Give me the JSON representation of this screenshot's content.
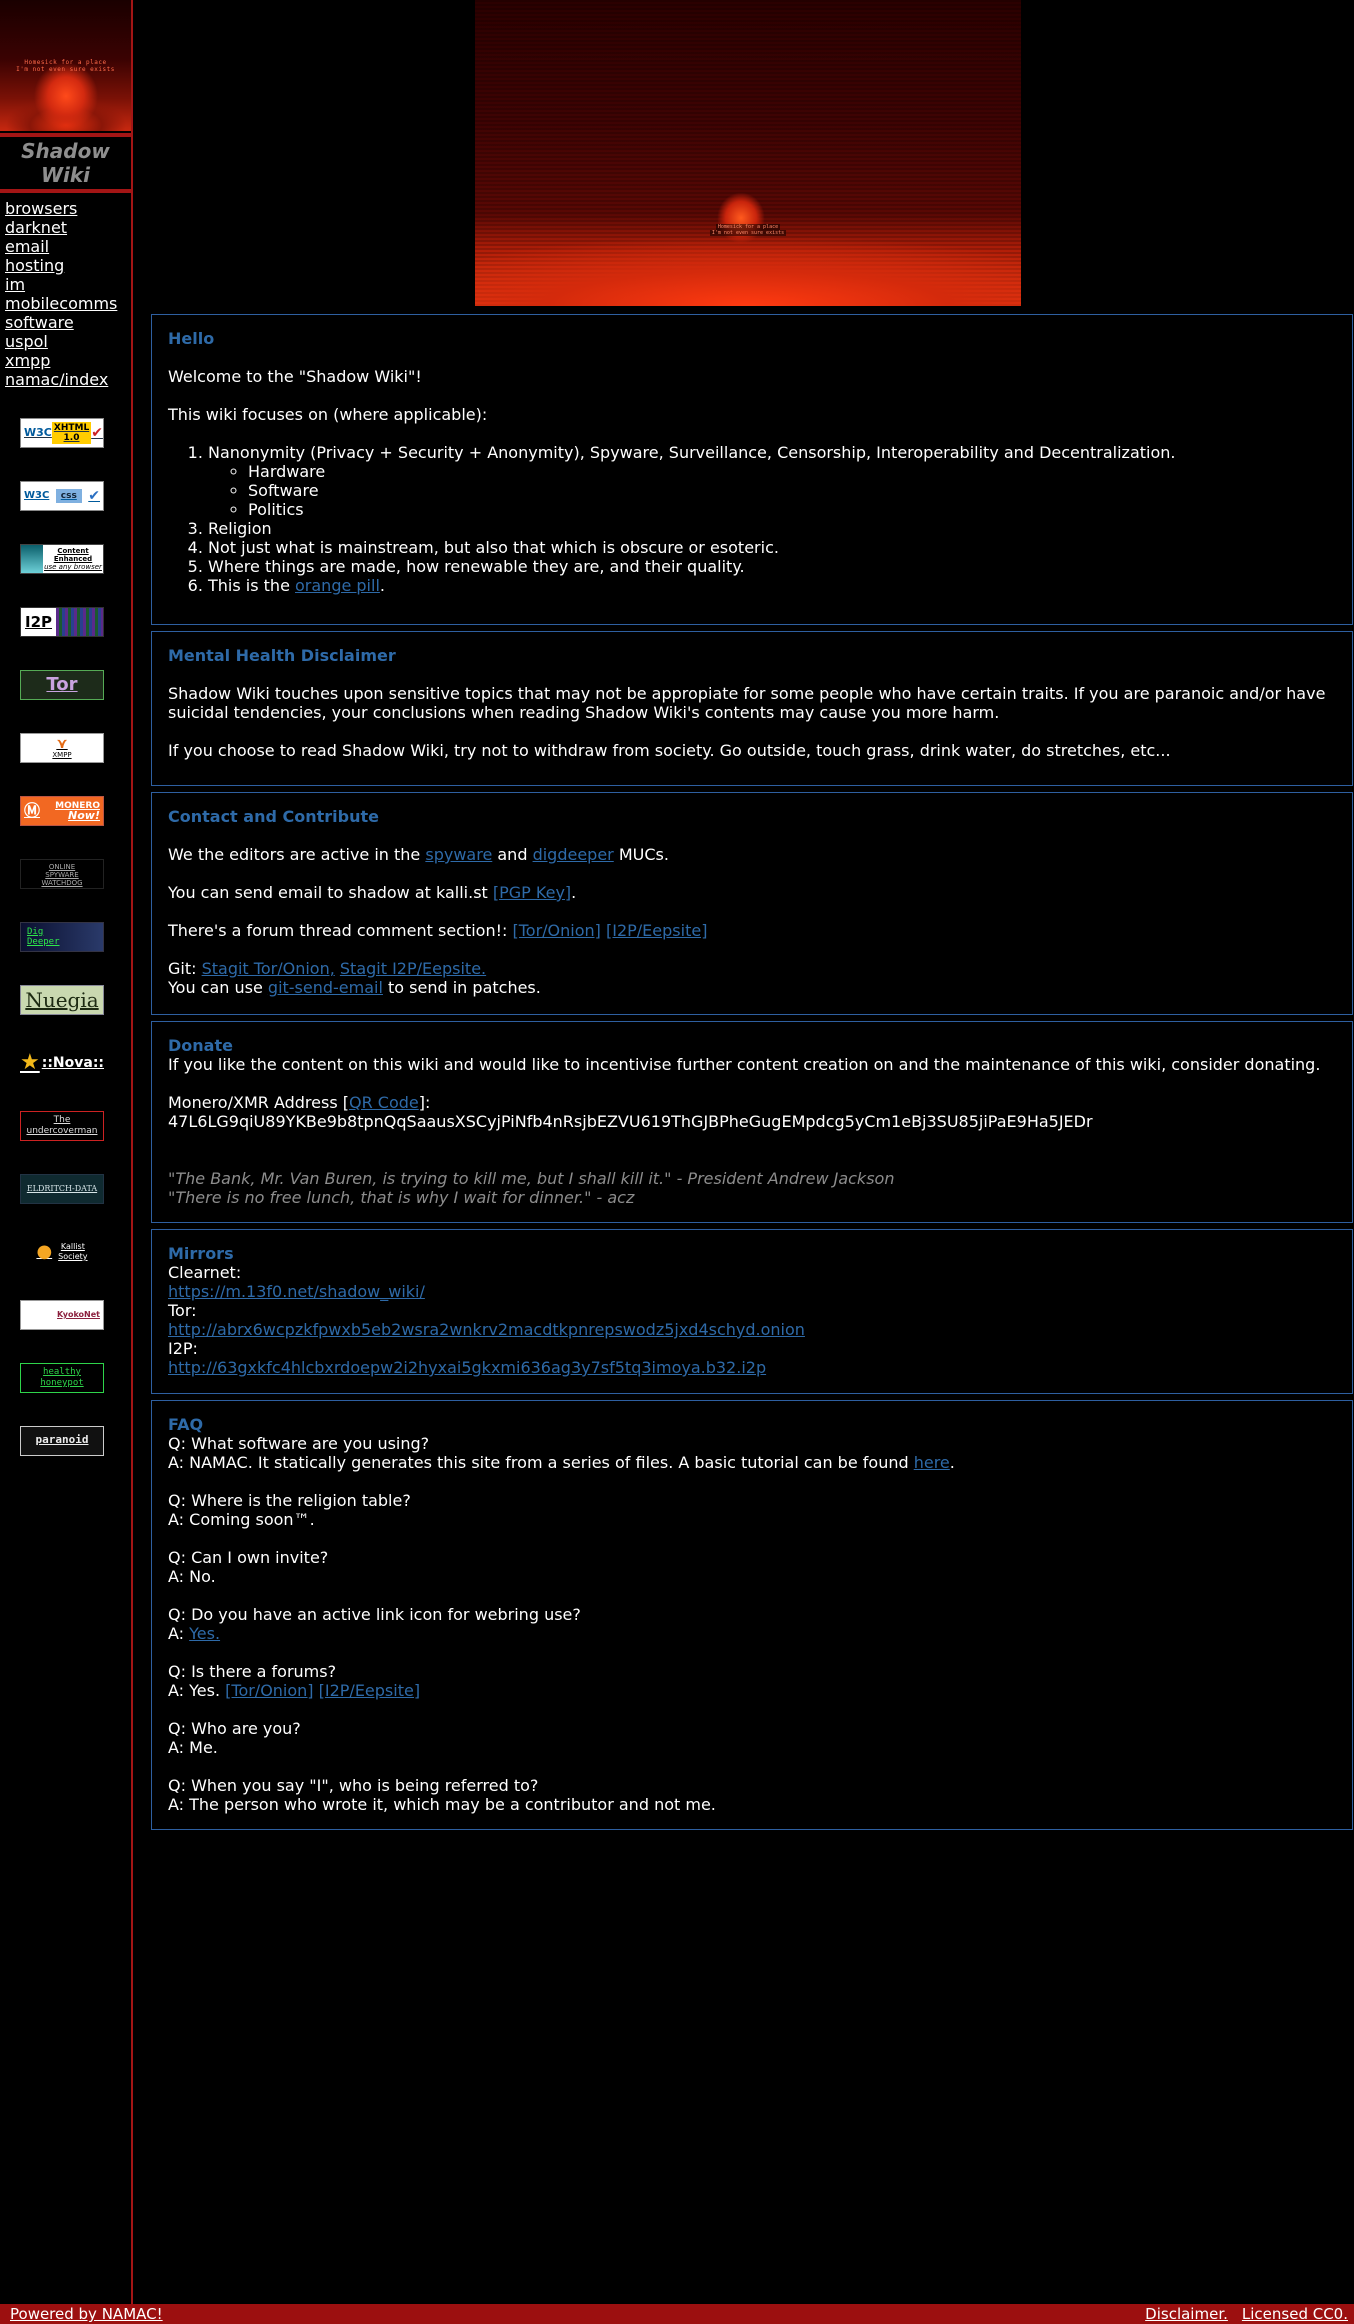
{
  "sidebar": {
    "logo_text_line1": "Homesick for a place",
    "logo_text_line2": "I'm not even sure exists",
    "title": "Shadow Wiki",
    "nav": [
      "browsers",
      "darknet",
      "email",
      "hosting",
      "im",
      "mobilecomms",
      "software",
      "uspol",
      "xmpp",
      "namac/index"
    ],
    "badges": {
      "xhtml_w3c": "W3C",
      "xhtml_label": "XHTML",
      "xhtml_version": "1.0",
      "css_w3c": "W3C",
      "css_label": "css",
      "content_line1": "Content",
      "content_line2": "Enhanced",
      "content_line3": "use any browser",
      "i2p": "I2P",
      "tor": "Tor",
      "xmpp": "XMPP",
      "monero_line1": "MONERO",
      "monero_line2": "Now!",
      "watchdog_line1": "ONLINE",
      "watchdog_line2": "SPYWARE",
      "watchdog_line3": "WATCHDOG",
      "digdeeper_line1": "Dig",
      "digdeeper_line2": "Deeper",
      "nuegia": "Nuegia",
      "nova": "::Nova::",
      "undercoverman_line1": "The",
      "undercoverman_line2": "undercoverman",
      "eldritch": "ELDRITCH-DATA",
      "kalliste_line1": "Kallist",
      "kalliste_line2": "Society",
      "kyoko": "KyokoNet",
      "healthy_line1": "healthy",
      "healthy_line2": "honeypot",
      "paranoid": "paranoid"
    }
  },
  "banner": {
    "text_line1": "Homesick for a place",
    "text_line2": "I'm not even sure exists"
  },
  "hello": {
    "title": "Hello",
    "welcome": "Welcome to the \"Shadow Wiki\"!",
    "focus_intro": "This wiki focuses on (where applicable):",
    "item1": "Nanonymity (Privacy + Security + Anonymity), Spyware, Surveillance, Censorship, Interoperability and Decentralization.",
    "subitems": [
      "Hardware",
      "Software",
      "Politics"
    ],
    "item3": "Religion",
    "item4": "Not just what is mainstream, but also that which is obscure or esoteric.",
    "item5": "Where things are made, how renewable they are, and their quality.",
    "item6_prefix": "This is the ",
    "item6_link": "orange pill",
    "item6_suffix": "."
  },
  "health": {
    "title": "Mental Health Disclaimer",
    "p1": "Shadow Wiki touches upon sensitive topics that may not be appropiate for some people who have certain traits. If you are paranoic and/or have suicidal tendencies, your conclusions when reading Shadow Wiki's contents may cause you more harm.",
    "p2": "If you choose to read Shadow Wiki, try not to withdraw from society. Go outside, touch grass, drink water, do stretches, etc..."
  },
  "contact": {
    "title": "Contact and Contribute",
    "editors_prefix": "We the editors are active in the ",
    "spyware_link": "spyware",
    "editors_and": " and ",
    "digdeeper_link": "digdeeper",
    "editors_suffix": " MUCs.",
    "email_prefix": "You can send email to shadow at kalli.st ",
    "pgp_link": "[PGP Key]",
    "email_suffix": ".",
    "forum_prefix": "There's a forum thread comment section!: ",
    "forum_tor_link": "[Tor/Onion]",
    "forum_i2p_link": "[I2P/Eepsite]",
    "git_prefix": "Git: ",
    "git_tor_link": "Stagit Tor/Onion,",
    "git_i2p_link": "Stagit I2P/Eepsite.",
    "patch_prefix": "You can use ",
    "patch_link": "git-send-email",
    "patch_suffix": " to send in patches."
  },
  "donate": {
    "title": "Donate",
    "intro": "If you like the content on this wiki and would like to incentivise further content creation on and the maintenance of this wiki, consider donating.",
    "address_prefix": "Monero/XMR Address [",
    "qr_link": "QR Code",
    "address_suffix": "]:",
    "address": "47L6LG9qiU89YKBe9b8tpnQqSaausXSCyjPiNfb4nRsjbEZVU619ThGJBPheGugEMpdcg5yCm1eBj3SU85jiPaE9Ha5JEDr",
    "quote1": "\"The Bank, Mr. Van Buren, is trying to kill me, but I shall kill it.\" - President Andrew Jackson",
    "quote2": "\"There is no free lunch, that is why I wait for dinner.\" - acz"
  },
  "mirrors": {
    "title": "Mirrors",
    "clearnet_label": "Clearnet:",
    "clearnet_url": "https://m.13f0.net/shadow_wiki/",
    "tor_label": "Tor:",
    "tor_url": "http://abrx6wcpzkfpwxb5eb2wsra2wnkrv2macdtkpnrepswodz5jxd4schyd.onion",
    "i2p_label": "I2P:",
    "i2p_url": "http://63gxkfc4hlcbxrdoepw2i2hyxai5gkxmi636ag3y7sf5tq3imoya.b32.i2p"
  },
  "faq": {
    "title": "FAQ",
    "q1": "Q: What software are you using?",
    "a1_prefix": "A: NAMAC. It statically generates this site from a series of files. A basic tutorial can be found ",
    "a1_link": "here",
    "a1_suffix": ".",
    "q2": "Q: Where is the religion table?",
    "a2": "A: Coming soon™.",
    "q3": "Q: Can I own invite?",
    "a3": "A: No.",
    "q4": "Q: Do you have an active link icon for webring use?",
    "a4_prefix": "A: ",
    "a4_link": "Yes.",
    "q5": "Q: Is there a forums?",
    "a5_prefix": "A: Yes. ",
    "a5_tor_link": "[Tor/Onion]",
    "a5_i2p_link": "[I2P/Eepsite]",
    "q6": "Q: Who are you?",
    "a6": "A: Me.",
    "q7": "Q: When you say \"I\", who is being referred to?",
    "a7": "A: The person who wrote it, which may be a contributor and not me."
  },
  "footer": {
    "powered": "Powered by NAMAC!",
    "disclaimer": "Disclaimer.",
    "license": "Licensed CC0."
  }
}
